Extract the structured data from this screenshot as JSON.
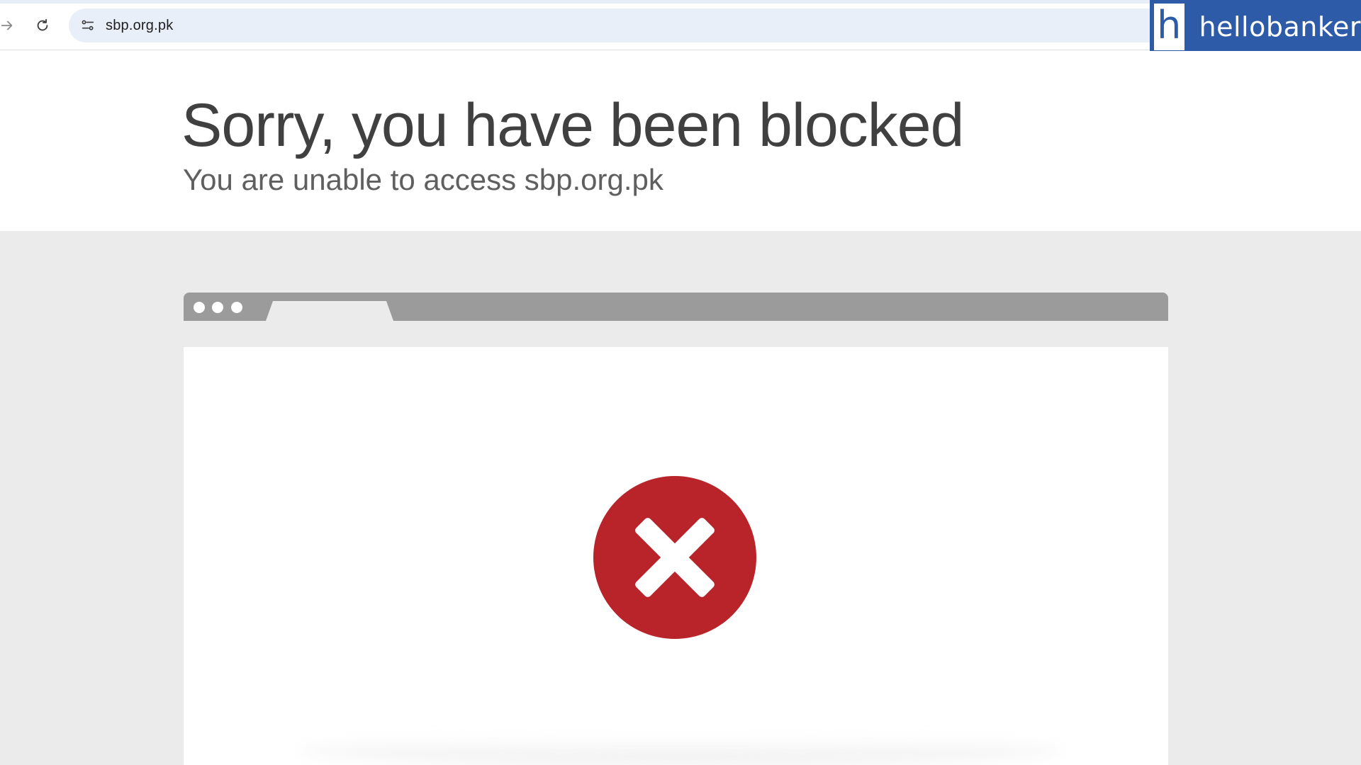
{
  "browser": {
    "url": "sbp.org.pk"
  },
  "brand": {
    "mark": "h",
    "name": "hellobanker"
  },
  "page": {
    "headline": "Sorry, you have been blocked",
    "subline": "You are unable to access sbp.org.pk"
  },
  "colors": {
    "block_icon": "#b8242a",
    "brand": "#2e5ba8",
    "illustration_bar": "#9b9b9b",
    "gray_area": "#ebebeb"
  },
  "icons": {
    "forward": "arrow-right-icon",
    "reload": "reload-icon",
    "site_info": "tune-icon",
    "block": "x-circle-icon"
  }
}
